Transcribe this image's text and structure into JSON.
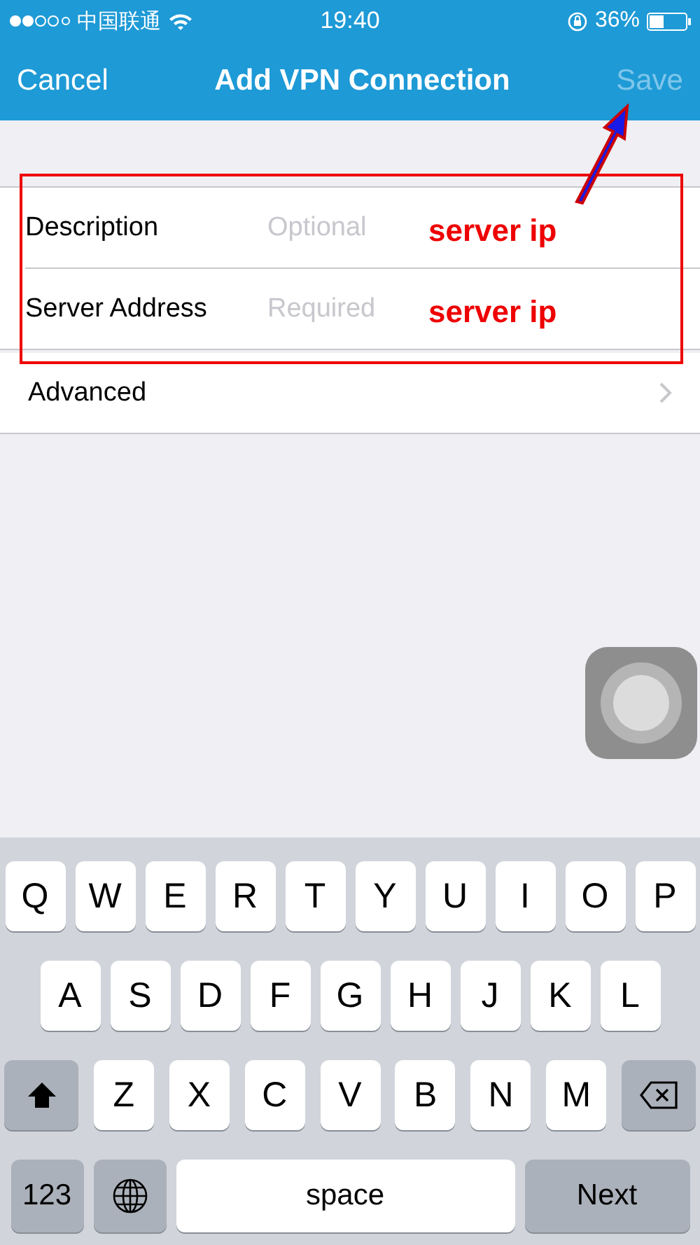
{
  "status_bar": {
    "carrier": "中国联通",
    "time": "19:40",
    "battery": "36%"
  },
  "nav_bar": {
    "cancel": "Cancel",
    "title": "Add VPN Connection",
    "save": {
      "label": "Save",
      "disabled": true
    }
  },
  "form": {
    "fields": [
      {
        "label": "Description",
        "placeholder": "Optional"
      },
      {
        "label": "Server Address",
        "placeholder": "Required"
      }
    ],
    "advanced": {
      "label": "Advanced"
    }
  },
  "annotations": [
    {
      "text": "server ip"
    },
    {
      "text": "server ip"
    }
  ],
  "keyboard": {
    "letter_rows": [
      [
        {
          "kind": "letter",
          "label": "Q"
        },
        {
          "kind": "letter",
          "label": "W"
        },
        {
          "kind": "letter",
          "label": "E"
        },
        {
          "kind": "letter",
          "label": "R"
        },
        {
          "kind": "letter",
          "label": "T"
        },
        {
          "kind": "letter",
          "label": "Y"
        },
        {
          "kind": "letter",
          "label": "U"
        },
        {
          "kind": "letter",
          "label": "I"
        },
        {
          "kind": "letter",
          "label": "O"
        },
        {
          "kind": "letter",
          "label": "P"
        }
      ],
      [
        {
          "kind": "letter",
          "label": "A"
        },
        {
          "kind": "letter",
          "label": "S"
        },
        {
          "kind": "letter",
          "label": "D"
        },
        {
          "kind": "letter",
          "label": "F"
        },
        {
          "kind": "letter",
          "label": "G"
        },
        {
          "kind": "letter",
          "label": "H"
        },
        {
          "kind": "letter",
          "label": "J"
        },
        {
          "kind": "letter",
          "label": "K"
        },
        {
          "kind": "letter",
          "label": "L"
        }
      ],
      [
        {
          "kind": "shift"
        },
        {
          "kind": "letter",
          "label": "Z"
        },
        {
          "kind": "letter",
          "label": "X"
        },
        {
          "kind": "letter",
          "label": "C"
        },
        {
          "kind": "letter",
          "label": "V"
        },
        {
          "kind": "letter",
          "label": "B"
        },
        {
          "kind": "letter",
          "label": "N"
        },
        {
          "kind": "letter",
          "label": "M"
        },
        {
          "kind": "delete"
        }
      ]
    ],
    "bottom_row": {
      "numbers": "123",
      "space": "space",
      "return": "Next"
    }
  }
}
